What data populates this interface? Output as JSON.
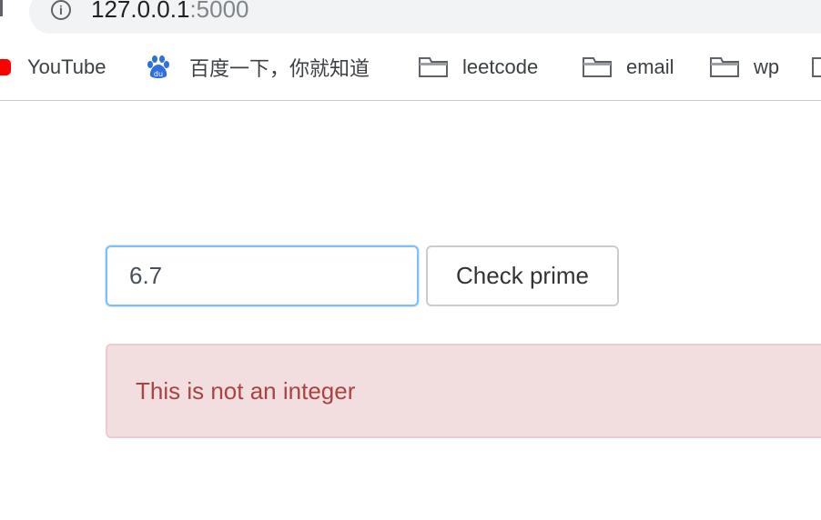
{
  "browser": {
    "url_host": "127.0.0.1",
    "url_port": ":5000",
    "bookmarks": [
      {
        "label": "YouTube",
        "icon": "youtube-icon"
      },
      {
        "label": "百度一下，你就知道",
        "icon": "baidu-icon"
      },
      {
        "label": "leetcode",
        "icon": "folder-icon"
      },
      {
        "label": "email",
        "icon": "folder-icon"
      },
      {
        "label": "wp",
        "icon": "folder-icon"
      }
    ]
  },
  "form": {
    "input_value": "6.7",
    "button_label": "Check prime"
  },
  "alert": {
    "message": "This is not an integer",
    "colors": {
      "background": "#f2dede",
      "border": "#ebccd1",
      "text": "#a94442"
    }
  }
}
